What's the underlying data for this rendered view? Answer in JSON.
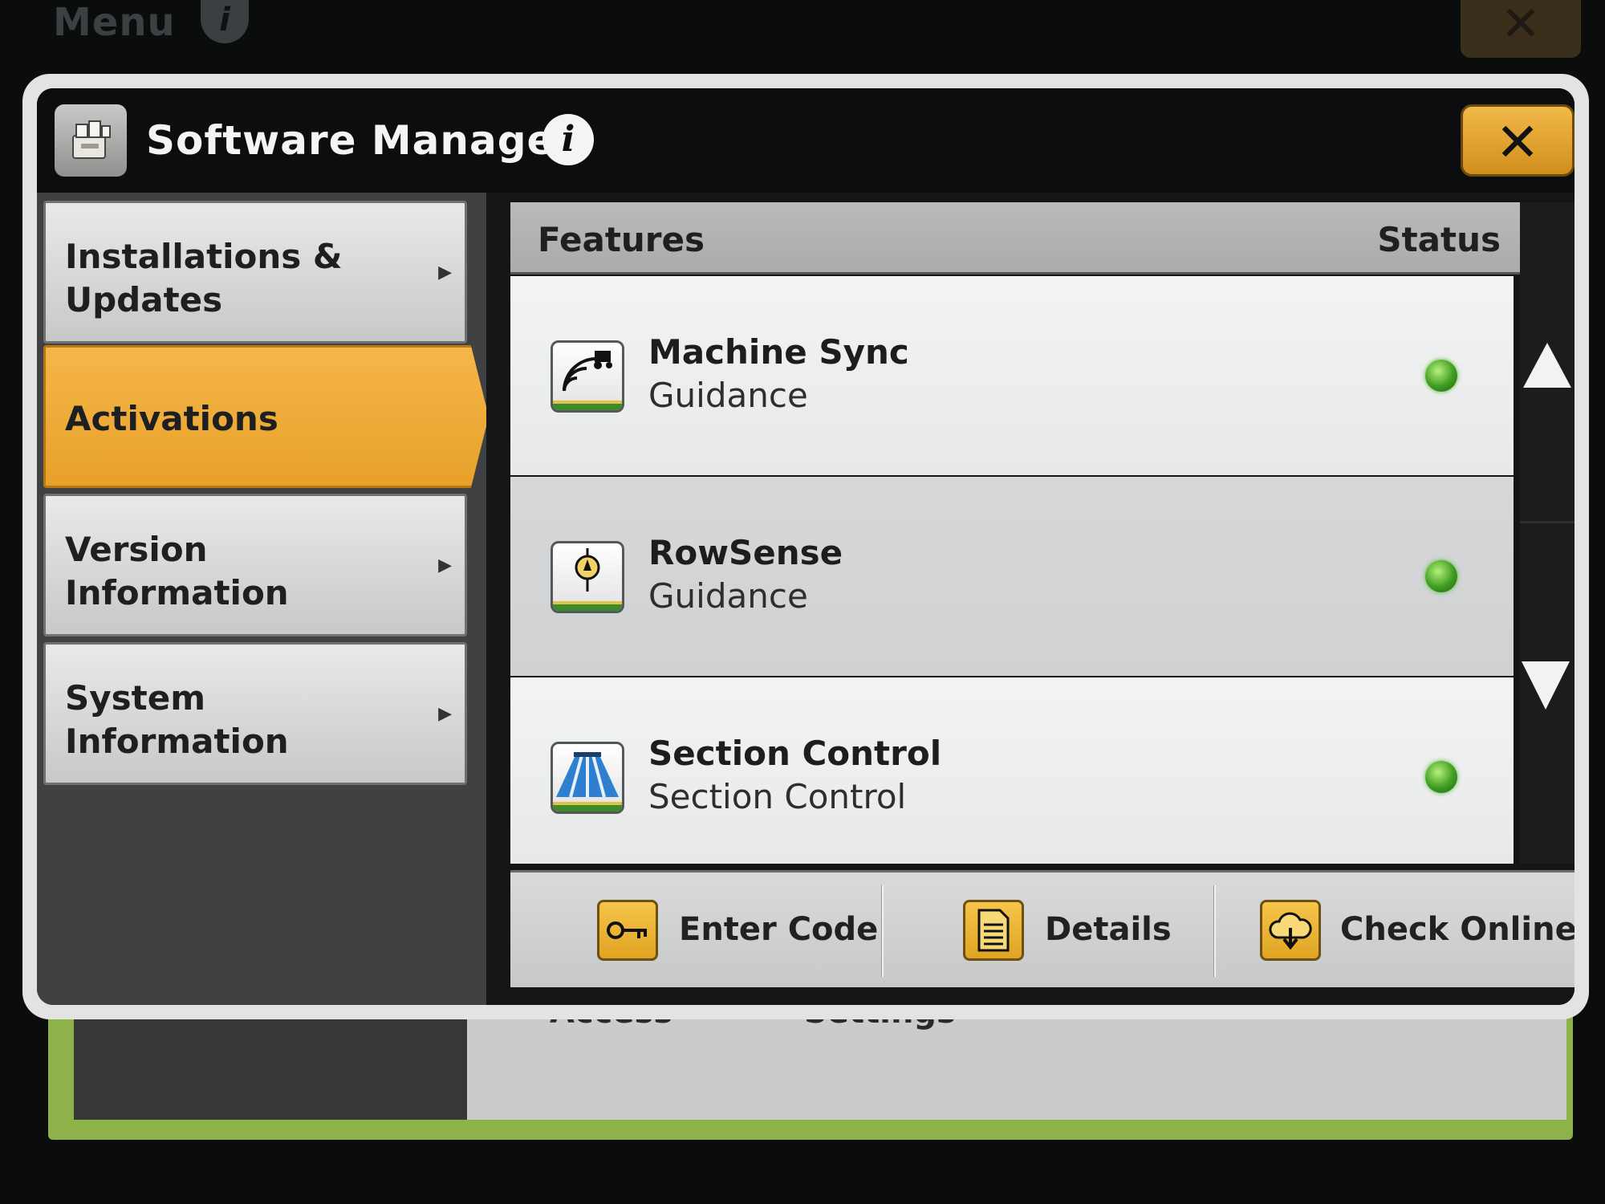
{
  "background": {
    "menu_label": "Menu",
    "bottom_labels": "Access Settings"
  },
  "dialog": {
    "title": "Software Manager",
    "info_glyph": "i",
    "close_glyph": "✕"
  },
  "nav": {
    "items": [
      {
        "label": "Installations & Updates",
        "selected": false
      },
      {
        "label": "Activations",
        "selected": true
      },
      {
        "label": "Version Information",
        "selected": false
      },
      {
        "label": "System Information",
        "selected": false
      }
    ]
  },
  "table": {
    "col_features": "Features",
    "col_status": "Status",
    "rows": [
      {
        "name": "Machine Sync",
        "type": "Guidance",
        "icon": "machine-sync-icon",
        "status": "active"
      },
      {
        "name": "RowSense",
        "type": "Guidance",
        "icon": "rowsense-icon",
        "status": "active"
      },
      {
        "name": "Section Control",
        "type": "Section Control",
        "icon": "section-control-icon",
        "status": "active"
      }
    ]
  },
  "footer": {
    "enter_code": "Enter Code",
    "details": "Details",
    "check_online": "Check Online"
  },
  "colors": {
    "accent": "#F0AE3C",
    "status_active": "#4CBF2A",
    "title_bar": "#0C0D0E"
  }
}
